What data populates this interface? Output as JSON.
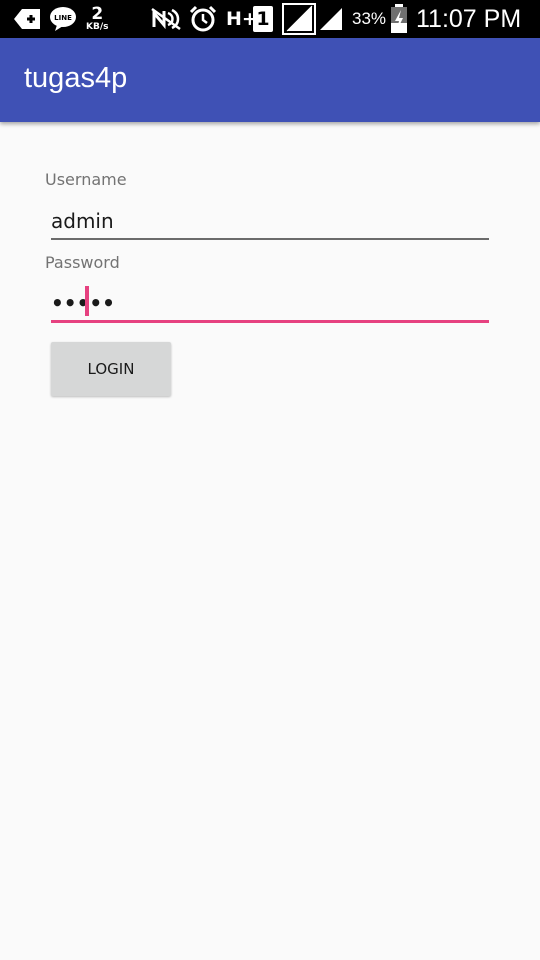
{
  "status_bar": {
    "line_app_label": "LINE",
    "speed_value": "2",
    "speed_unit": "KB/s",
    "network_type": "H+",
    "sim_slot": "1",
    "battery_percent": "33%",
    "time": "11:07 PM"
  },
  "app_bar": {
    "title": "tugas4p"
  },
  "form": {
    "username_label": "Username",
    "username_value": "admin",
    "password_label": "Password",
    "password_masked": "•••••",
    "login_label": "LOGIN"
  },
  "colors": {
    "primary": "#3f51b5",
    "accent": "#e64180",
    "background": "#fafafa"
  }
}
